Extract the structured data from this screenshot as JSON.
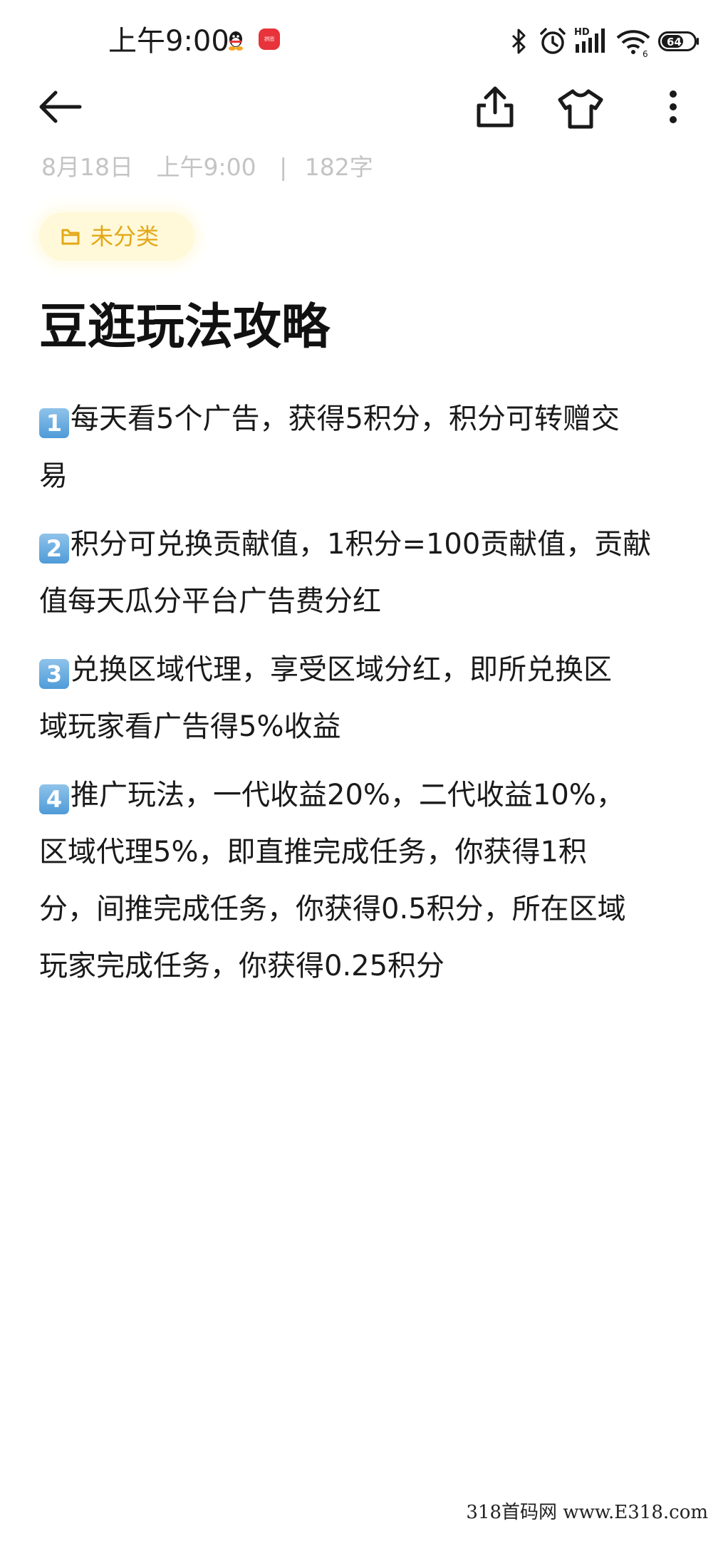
{
  "status_bar": {
    "time": "上午9:00",
    "app_icon_text": "拼团",
    "icons": [
      "qq-icon",
      "app-notification-icon",
      "bluetooth-icon",
      "alarm-icon",
      "hd-signal-icon",
      "wifi-icon",
      "battery-icon"
    ],
    "signal_label": "HD",
    "wifi_label": "6",
    "battery_level": "64"
  },
  "toolbar": {
    "icons": [
      "back-arrow-icon",
      "share-icon",
      "tshirt-icon",
      "more-vertical-icon"
    ]
  },
  "meta": {
    "date": "8月18日",
    "time": "上午9:00",
    "separator": "|",
    "word_count": "182字"
  },
  "category": {
    "label": "未分类",
    "icon": "folder-icon",
    "color": "#e3a817"
  },
  "note": {
    "title": "豆逛玩法攻略",
    "paragraphs": [
      {
        "badge": "1",
        "lines": [
          "每天看5个广告，获得5积分，积分可转赠交",
          "易"
        ]
      },
      {
        "badge": "2",
        "lines": [
          "积分可兑换贡献值，1积分=100贡献值，贡献",
          "值每天瓜分平台广告费分红"
        ]
      },
      {
        "badge": "3",
        "lines": [
          "兑换区域代理，享受区域分红，即所兑换区",
          "域玩家看广告得5%收益"
        ]
      },
      {
        "badge": "4",
        "lines": [
          "推广玩法，一代收益20%，二代收益10%，",
          "区域代理5%，即直推完成任务，你获得1积",
          "分，间推完成任务，你获得0.5积分，所在区域",
          "玩家完成任务，你获得0.25积分"
        ]
      }
    ]
  },
  "watermark": "318首码网 www.E318.com",
  "colors": {
    "badge": "#5aa3dc",
    "meta_text": "#c4c4c4",
    "chip_bg": "#fff9d9"
  }
}
